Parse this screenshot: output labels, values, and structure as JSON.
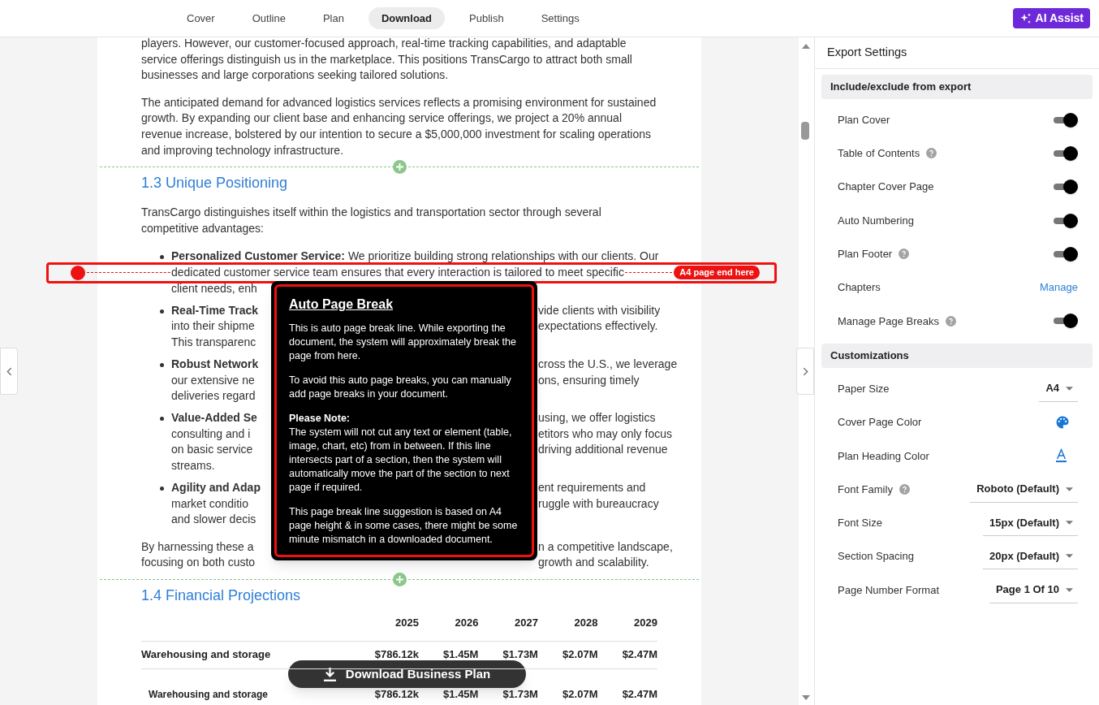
{
  "nav": {
    "tabs": [
      {
        "label": "Cover",
        "selected": false
      },
      {
        "label": "Outline",
        "selected": false
      },
      {
        "label": "Plan",
        "selected": false
      },
      {
        "label": "Download",
        "selected": true
      },
      {
        "label": "Publish",
        "selected": false
      },
      {
        "label": "Settings",
        "selected": false
      }
    ],
    "ai_button": "AI Assist"
  },
  "document": {
    "intro_paragraphs": [
      "players. However, our customer-focused approach, real-time tracking capabilities, and adaptable service offerings distinguish us in the marketplace. This positions TransCargo to attract both small businesses and large corporations seeking tailored solutions.",
      "The anticipated demand for advanced logistics services reflects a promising environment for sustained growth. By expanding our client base and enhancing service offerings, we project a 20% annual revenue increase, bolstered by our intention to secure a $5,000,000 investment for scaling operations and improving technology infrastructure."
    ],
    "section_heading": "1.3 Unique Positioning",
    "section_intro": "TransCargo distinguishes itself within the logistics and transportation sector through several competitive advantages:",
    "first_bullet": {
      "title": "Personalized Customer Service:",
      "lines": [
        "We prioritize building strong relationships with our clients. Our",
        "dedicated customer service team ensures that every interaction is tailored to meet specific",
        "client needs, enh"
      ]
    },
    "page_break": {
      "badge": "A4 page end here"
    },
    "bullets": [
      {
        "title": "Real-Time Track",
        "lines": [
          {
            "right": "vide clients with visibility"
          },
          {
            "left": "into their shipme",
            "right": "expectations effectively."
          },
          {
            "left": "This transparenc"
          }
        ]
      },
      {
        "title": "Robust Network",
        "lines": [
          {
            "right": "cross the U.S., we leverage"
          },
          {
            "left": "our extensive ne",
            "right": "ons, ensuring timely"
          },
          {
            "left": "deliveries regard"
          }
        ]
      },
      {
        "title": "Value-Added Se",
        "lines": [
          {
            "right": "using, we offer logistics"
          },
          {
            "left": "consulting and i",
            "right": "etitors who may only focus"
          },
          {
            "left": "on basic service",
            "right": "driving additional revenue"
          },
          {
            "left": "streams."
          }
        ]
      },
      {
        "title": "Agility and Adap",
        "lines": [
          {
            "right": "ent requirements and"
          },
          {
            "left": "market conditio",
            "right": "ruggle with bureaucracy"
          },
          {
            "left": "and slower decis"
          }
        ]
      }
    ],
    "closing_lines": [
      {
        "left": "By harnessing these a",
        "right": "n a competitive landscape,"
      },
      {
        "left": "focusing on both custo",
        "right": "growth and scalability."
      }
    ],
    "tooltip": {
      "title": "Auto Page Break",
      "paragraphs": [
        {
          "text": "This is auto page break line. While exporting the document, the system will approximately break the page from here."
        },
        {
          "text": "To avoid this auto page breaks, you can manually add page breaks in your document."
        },
        {
          "lead": "Please Note:",
          "text": "The system will not cut any text or element (table, image, chart, etc) from in between. If this line intersects part of a section, then the system will automatically move the part of the section to next page if required."
        },
        {
          "text": "This page break line suggestion is based on A4 page height & in some cases, there might be some minute mismatch in a downloaded document."
        }
      ]
    },
    "table_heading": "1.4 Financial Projections",
    "table": {
      "columns": [
        "2025",
        "2026",
        "2027",
        "2028",
        "2029"
      ],
      "rows": [
        {
          "label": "Warehousing and storage",
          "kind": "group",
          "values": [
            "$786.12k",
            "$1.45M",
            "$1.73M",
            "$2.07M",
            "$2.47M"
          ]
        },
        {
          "label": "Warehousing and storage",
          "kind": "item",
          "values": [
            "$786.12k",
            "$1.45M",
            "$1.73M",
            "$2.07M",
            "$2.47M"
          ]
        }
      ]
    },
    "download_button": "Download Business Plan"
  },
  "export_settings": {
    "title": "Export Settings",
    "sections": [
      {
        "heading": "Include/exclude from export",
        "rows": [
          {
            "label": "Plan Cover",
            "help": false,
            "kind": "toggle",
            "on": true
          },
          {
            "label": "Table of Contents",
            "help": true,
            "kind": "toggle",
            "on": true
          },
          {
            "label": "Chapter Cover Page",
            "help": false,
            "kind": "toggle",
            "on": true
          },
          {
            "label": "Auto Numbering",
            "help": false,
            "kind": "toggle",
            "on": true
          },
          {
            "label": "Plan Footer",
            "help": true,
            "kind": "toggle",
            "on": true
          },
          {
            "label": "Chapters",
            "help": false,
            "kind": "link",
            "value": "Manage"
          },
          {
            "label": "Manage Page Breaks",
            "help": true,
            "kind": "toggle",
            "on": true
          }
        ]
      },
      {
        "heading": "Customizations",
        "rows": [
          {
            "label": "Paper Size",
            "help": false,
            "kind": "select",
            "value": "A4"
          },
          {
            "label": "Cover Page Color",
            "help": false,
            "kind": "palette"
          },
          {
            "label": "Plan Heading Color",
            "help": false,
            "kind": "text_color"
          },
          {
            "label": "Font Family",
            "help": true,
            "kind": "select",
            "value": "Roboto (Default)"
          },
          {
            "label": "Font Size",
            "help": false,
            "kind": "select",
            "value": "15px (Default)"
          },
          {
            "label": "Section Spacing",
            "help": false,
            "kind": "select",
            "value": "20px (Default)"
          },
          {
            "label": "Page Number Format",
            "help": false,
            "kind": "select",
            "value": "Page 1 Of 10"
          }
        ]
      }
    ]
  }
}
